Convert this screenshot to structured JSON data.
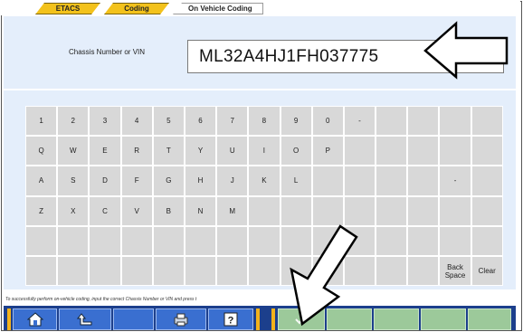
{
  "tabs": [
    {
      "label": "ETACS"
    },
    {
      "label": "Coding"
    },
    {
      "label": "On Vehicle Coding"
    }
  ],
  "vin": {
    "label": "Chassis Number or VIN",
    "value": "ML32A4HJ1FH037775"
  },
  "keyboard": {
    "rows": [
      [
        "1",
        "2",
        "3",
        "4",
        "5",
        "6",
        "7",
        "8",
        "9",
        "0",
        "-",
        "",
        "",
        "",
        ""
      ],
      [
        "Q",
        "W",
        "E",
        "R",
        "T",
        "Y",
        "U",
        "I",
        "O",
        "P",
        "",
        "",
        "",
        "",
        ""
      ],
      [
        "A",
        "S",
        "D",
        "F",
        "G",
        "H",
        "J",
        "K",
        "L",
        "",
        "",
        "",
        "",
        "-",
        ""
      ],
      [
        "Z",
        "X",
        "C",
        "V",
        "B",
        "N",
        "M",
        "",
        "",
        "",
        "",
        "",
        "",
        "",
        ""
      ],
      [
        "",
        "",
        "",
        "",
        "",
        "",
        "",
        "",
        "",
        "",
        "",
        "",
        "",
        "",
        ""
      ],
      [
        "",
        "",
        "",
        "",
        "",
        "",
        "",
        "",
        "",
        "",
        "",
        "",
        "",
        "Back Space",
        "Clear"
      ]
    ]
  },
  "status": {
    "text": "To successfully perform on-vehicle coding, input the correct Chassis Number or VIN and press t"
  },
  "toolbar": {
    "buttons": [
      {
        "icon": "home-icon"
      },
      {
        "icon": "back-icon"
      },
      {
        "icon": "blank"
      },
      {
        "icon": "print-icon"
      },
      {
        "icon": "help-icon"
      },
      {
        "icon": "check-icon"
      }
    ]
  },
  "colors": {
    "accent": "#f3c21b",
    "panel": "#e4eefb",
    "toolbar": "#1c3f8c",
    "confirm": "#9cc99a"
  }
}
